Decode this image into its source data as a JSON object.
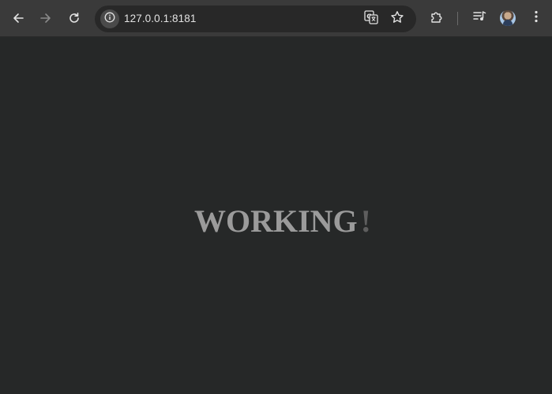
{
  "browser": {
    "url": "127.0.0.1:8181",
    "nav": {
      "back_icon": "arrow-left-icon",
      "forward_icon": "arrow-right-icon",
      "reload_icon": "reload-icon"
    },
    "omnibox_icons": [
      "site-info-icon",
      "translate-icon",
      "star-icon"
    ],
    "toolbar_icons": [
      "extensions-icon",
      "media-controls-icon",
      "profile-avatar",
      "more-menu-icon"
    ]
  },
  "page": {
    "headline_word": "WORKING",
    "headline_punct": "!"
  },
  "colors": {
    "toolbar_bg": "#3a3a3a",
    "omnibox_bg": "#282828",
    "page_bg": "#262828",
    "headline_text": "#9b9b9b",
    "headline_punct": "#5e5e5e"
  }
}
